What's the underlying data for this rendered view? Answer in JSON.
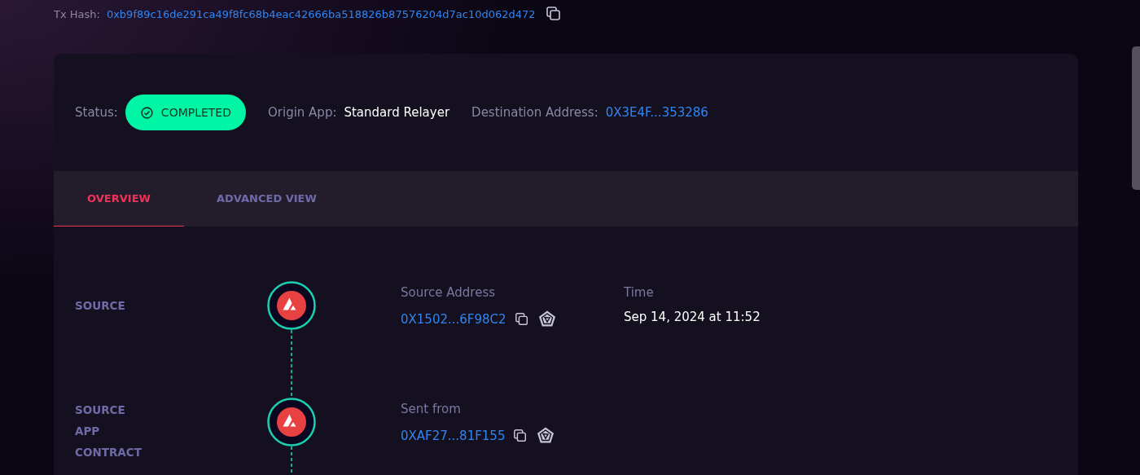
{
  "tx_hash": {
    "label": "Tx Hash:",
    "value": "0xb9f89c16de291ca49f8fc68b4eac42666ba518826b87576204d7ac10d062d472"
  },
  "summary": {
    "status_label": "Status:",
    "status": "COMPLETED",
    "origin_label": "Origin App:",
    "origin": "Standard Relayer",
    "destination_label": "Destination Address:",
    "destination": "0X3E4F...353286"
  },
  "tabs": [
    {
      "label": "OVERVIEW",
      "selected": true
    },
    {
      "label": "ADVANCED VIEW",
      "selected": false
    }
  ],
  "steps": [
    {
      "label": "SOURCE",
      "fields": [
        {
          "kind": "address",
          "label": "Source Address",
          "value": "0X1502...6F98C2"
        },
        {
          "kind": "text",
          "label": "Time",
          "value": "Sep 14, 2024 at 11:52"
        }
      ]
    },
    {
      "label": "SOURCE APP CONTRACT",
      "fields": [
        {
          "kind": "address",
          "label": "Sent from",
          "value": "0XAF27...81F155"
        }
      ]
    }
  ]
}
